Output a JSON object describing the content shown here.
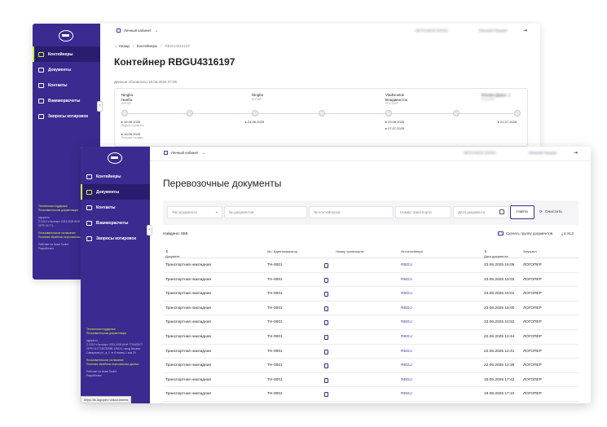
{
  "back_window": {
    "cabinet": "Личный кабинет",
    "company_blurred": "NETHANCE (ООО)",
    "user_blurred": "Евгений Пашкин",
    "nav": [
      {
        "label": "Контейнеры",
        "active": true
      },
      {
        "label": "Документы",
        "active": false
      },
      {
        "label": "Контакты",
        "active": false
      },
      {
        "label": "Взаиморасчеты",
        "active": false
      },
      {
        "label": "Запросы котировок",
        "active": false
      }
    ],
    "footer": {
      "support": "Техническая поддержка",
      "user_docs": "Пользовательская документация",
      "site": "logoper.ru",
      "legal": "© ООО «Логопер» 2023-2025 ИНН 7725402077 ОГРН 11771...",
      "agreement": "Пользовательское соглашение",
      "privacy": "Политика обработки персональных данных",
      "made_with": "Работает на Avast Toolkit",
      "dev": "Разработано"
    },
    "breadcrumb": {
      "back": "Назад",
      "section": "Контейнеры",
      "current": "RBGU4316197"
    },
    "title": "Контейнер RBGU4316197",
    "updated": "Данные обновлены 19.06.2025 07:05",
    "route": {
      "stops": [
        {
          "city": "Ningbo",
          "city2": "Нинбо",
          "country": "КИТАЙ"
        },
        {
          "city": "Ningbo",
          "city2": "",
          "country": "КИТАЙ"
        },
        {
          "city": "Vladivostok",
          "city2": "Владивосток",
          "country": "РОССИЯ"
        },
        {
          "city": "Москва (Дорог...)",
          "city2": "",
          "country": "РОССИЯ"
        }
      ],
      "dates": [
        {
          "date": "16.06.2025",
          "note": "Выдача порожнего"
        },
        {
          "date": "18.06.2025",
          "note": "Погрузка на судно"
        },
        {
          "date": "24.06.2025",
          "note": ""
        },
        {
          "date": "29.06.2025",
          "note": ""
        },
        {
          "date": "07.07.2025",
          "note": ""
        },
        {
          "date": "21.07.2025",
          "note": ""
        }
      ]
    }
  },
  "front_window": {
    "cabinet": "Личный кабинет",
    "company_blurred": "NETHANCE (ООО)",
    "user_blurred": "Евгений Пашкин",
    "nav": [
      {
        "label": "Контейнеры",
        "active": false
      },
      {
        "label": "Документы",
        "active": true
      },
      {
        "label": "Контакты",
        "active": false
      },
      {
        "label": "Взаиморасчеты",
        "active": false
      },
      {
        "label": "Запросы котировок",
        "active": false
      }
    ],
    "footer": {
      "support": "Техническая поддержка",
      "user_docs": "Пользовательская документация",
      "site": "logoper.ru",
      "legal": "© ООО «Логопер» 2023-2025 ИНН 7725402077 ОГРН 1177746722596 125124, город Москва, Самарская ул., д. 1, эт 8 помещ 1 ком 29",
      "agreement": "Пользовательское соглашение",
      "privacy": "Политика обработки персональных данных",
      "made_with": "Работает на Avast Toolkit",
      "dev": "Разработано"
    },
    "page_title": "Перевозочные документы",
    "filters": {
      "doc_type": "Тип документа",
      "doc_number": "№ документов",
      "container_number": "№ контейнеров",
      "transport_number": "Номер транспорта",
      "doc_date": "Дата документа",
      "find": "Найти",
      "clear": "Очистить"
    },
    "found": "Найдено: 658",
    "download_group": "Скачать группу документов",
    "download_xls": "в XLS",
    "table": {
      "headers": [
        "Документ",
        "№ / Идентификатор",
        "Номер транспорта",
        "№ контейнера",
        "Дата документа",
        "Загрузил"
      ],
      "rows": [
        {
          "doc": "Транспортная накладная",
          "id": "ТН-0001",
          "transport": "",
          "container": "RBGU",
          "date": "23.06.2025 15:05",
          "by": "ЛОГОПЕР"
        },
        {
          "doc": "Транспортная накладная",
          "id": "ТН-0001",
          "transport": "",
          "container": "RBGU",
          "date": "23.06.2025 15:03",
          "by": "ЛОГОПЕР"
        },
        {
          "doc": "Транспортная накладная",
          "id": "ТН-0001",
          "transport": "",
          "container": "RBGU",
          "date": "23.06.2025 15:01",
          "by": "ЛОГОПЕР"
        },
        {
          "doc": "Транспортная накладная",
          "id": "ТН-0001",
          "transport": "",
          "container": "RBGU",
          "date": "23.06.2025 15:00",
          "by": "ЛОГОПЕР"
        },
        {
          "doc": "Транспортная накладная",
          "id": "ТН-0001",
          "transport": "",
          "container": "RBGU",
          "date": "23.06.2025 10:52",
          "by": "ЛОГОПЕР"
        },
        {
          "doc": "Транспортная накладная",
          "id": "ТН-0001",
          "transport": "",
          "container": "RBGU",
          "date": "22.06.2025 12:44",
          "by": "ЛОГОПЕР"
        },
        {
          "doc": "Транспортная накладная",
          "id": "ТН-0001",
          "transport": "",
          "container": "RBGU",
          "date": "22.06.2025 12:41",
          "by": "ЛОГОПЕР"
        },
        {
          "doc": "Транспортная накладная",
          "id": "ТН-0001",
          "transport": "",
          "container": "RBGU",
          "date": "22.06.2025 12:39",
          "by": "ЛОГОПЕР"
        },
        {
          "doc": "Транспортная накладная",
          "id": "ТН-0001",
          "transport": "",
          "container": "RBGU",
          "date": "19.06.2025 17:42",
          "by": "ЛОГОПЕР"
        },
        {
          "doc": "Транспортная накладная",
          "id": "ТН-0001",
          "transport": "",
          "container": "RBGU",
          "date": "19.06.2025 17:10",
          "by": "ЛОГОПЕР"
        }
      ]
    },
    "status_url": "https://lk.logoper.ru/documents"
  }
}
